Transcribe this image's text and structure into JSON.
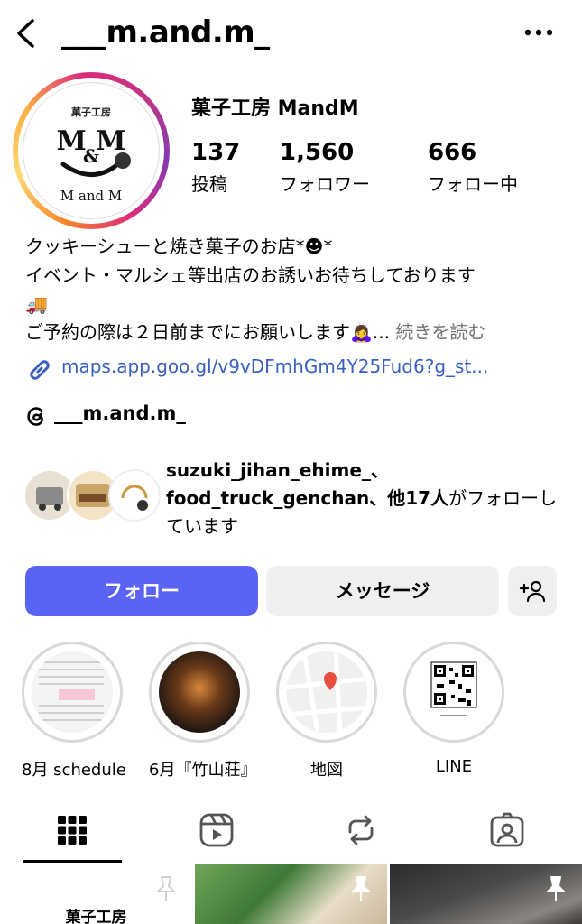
{
  "header": {
    "username": "___m.and.m_"
  },
  "profile": {
    "display_name": "菓子工房 MandM",
    "avatar_text": {
      "top": "菓子工房",
      "main": "M M",
      "amp": "&",
      "bottom": "M and M"
    },
    "stats": [
      {
        "value": "137",
        "label": "投稿"
      },
      {
        "value": "1,560",
        "label": "フォロワー"
      },
      {
        "value": "666",
        "label": "フォロー中"
      }
    ],
    "bio_lines": [
      "クッキーシューと焼き菓子のお店*☻*",
      "イベント・マルシェ等出店のお誘いお待ちしております",
      "🚚",
      "ご予約の際は２日前までにお願いします🙇‍♀️..."
    ],
    "bio_more": "続きを読む",
    "link": "maps.app.goo.gl/v9vDFmhGm4Y25Fud6?g_st...",
    "threads_handle": "___m.and.m_"
  },
  "mutual": {
    "names": "suzuki_jihan_ehime_、food_truck_genchan",
    "suffix_bold": "、他17人",
    "suffix": "がフォローしています"
  },
  "actions": {
    "follow": "フォロー",
    "message": "メッセージ"
  },
  "highlights": [
    {
      "label": "8月 schedule"
    },
    {
      "label": "6月『竹山荘』"
    },
    {
      "label": "地図"
    },
    {
      "label": "LINE"
    }
  ],
  "tabs": [
    "grid-icon",
    "reels-icon",
    "reposts-icon",
    "tagged-icon"
  ],
  "grid": {
    "first_cell_text": "菓子工房"
  },
  "colors": {
    "follow_button": "#5b63f5",
    "link": "#3a5fbf",
    "muted": "#737373"
  }
}
